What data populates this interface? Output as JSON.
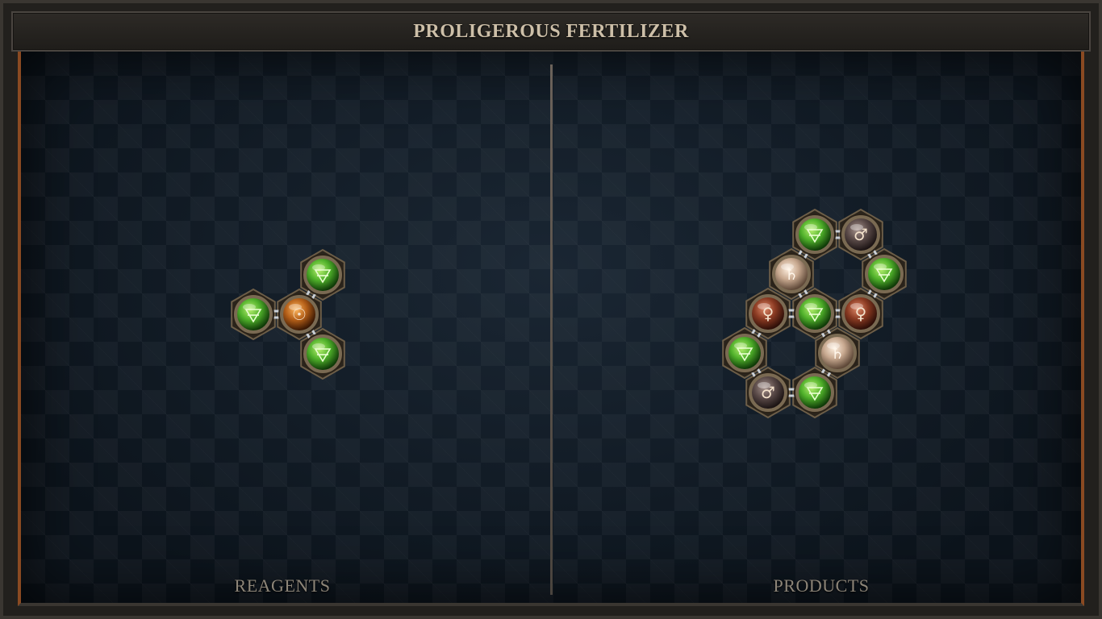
{
  "title": "PROLIGEROUS FERTILIZER",
  "panels": {
    "reagents_label": "REAGENTS",
    "products_label": "PRODUCTS"
  },
  "colors": {
    "earth": "#4fb02a",
    "fire": "#b45f18",
    "copper": "#8a3a22",
    "iron": "#5a4a48",
    "lead": "#c7a88f"
  },
  "reagent_molecule": {
    "atoms": [
      {
        "id": "r0",
        "type": "salt",
        "glyph": "☉",
        "color_key": "fire"
      },
      {
        "id": "r1",
        "type": "earth",
        "glyph": "🜃",
        "color_key": "earth"
      },
      {
        "id": "r2",
        "type": "earth",
        "glyph": "🜃",
        "color_key": "earth"
      },
      {
        "id": "r3",
        "type": "earth",
        "glyph": "🜃",
        "color_key": "earth"
      }
    ],
    "bonds": [
      [
        "r0",
        "r1"
      ],
      [
        "r0",
        "r2"
      ],
      [
        "r0",
        "r3"
      ]
    ]
  },
  "product_molecule": {
    "atoms": [
      {
        "id": "p0",
        "type": "earth",
        "glyph": "🜃",
        "color_key": "earth"
      },
      {
        "id": "p1",
        "type": "iron",
        "glyph": "♂",
        "color_key": "iron"
      },
      {
        "id": "p2",
        "type": "lead",
        "glyph": "♄",
        "color_key": "lead"
      },
      {
        "id": "p3",
        "type": "earth",
        "glyph": "🜃",
        "color_key": "earth"
      },
      {
        "id": "p4",
        "type": "copper",
        "glyph": "♀",
        "color_key": "copper"
      },
      {
        "id": "p5",
        "type": "earth",
        "glyph": "🜃",
        "color_key": "earth"
      },
      {
        "id": "p6",
        "type": "copper",
        "glyph": "♀",
        "color_key": "copper"
      },
      {
        "id": "p7",
        "type": "earth",
        "glyph": "🜃",
        "color_key": "earth"
      },
      {
        "id": "p8",
        "type": "lead",
        "glyph": "♄",
        "color_key": "lead"
      },
      {
        "id": "p9",
        "type": "iron",
        "glyph": "♂",
        "color_key": "iron"
      },
      {
        "id": "p10",
        "type": "earth",
        "glyph": "🜃",
        "color_key": "earth"
      }
    ],
    "bonds": [
      [
        "p0",
        "p1"
      ],
      [
        "p0",
        "p2"
      ],
      [
        "p1",
        "p3"
      ],
      [
        "p2",
        "p5"
      ],
      [
        "p3",
        "p6"
      ],
      [
        "p4",
        "p5"
      ],
      [
        "p5",
        "p6"
      ],
      [
        "p4",
        "p7"
      ],
      [
        "p5",
        "p8"
      ],
      [
        "p7",
        "p9"
      ],
      [
        "p8",
        "p10"
      ],
      [
        "p9",
        "p10"
      ]
    ]
  }
}
